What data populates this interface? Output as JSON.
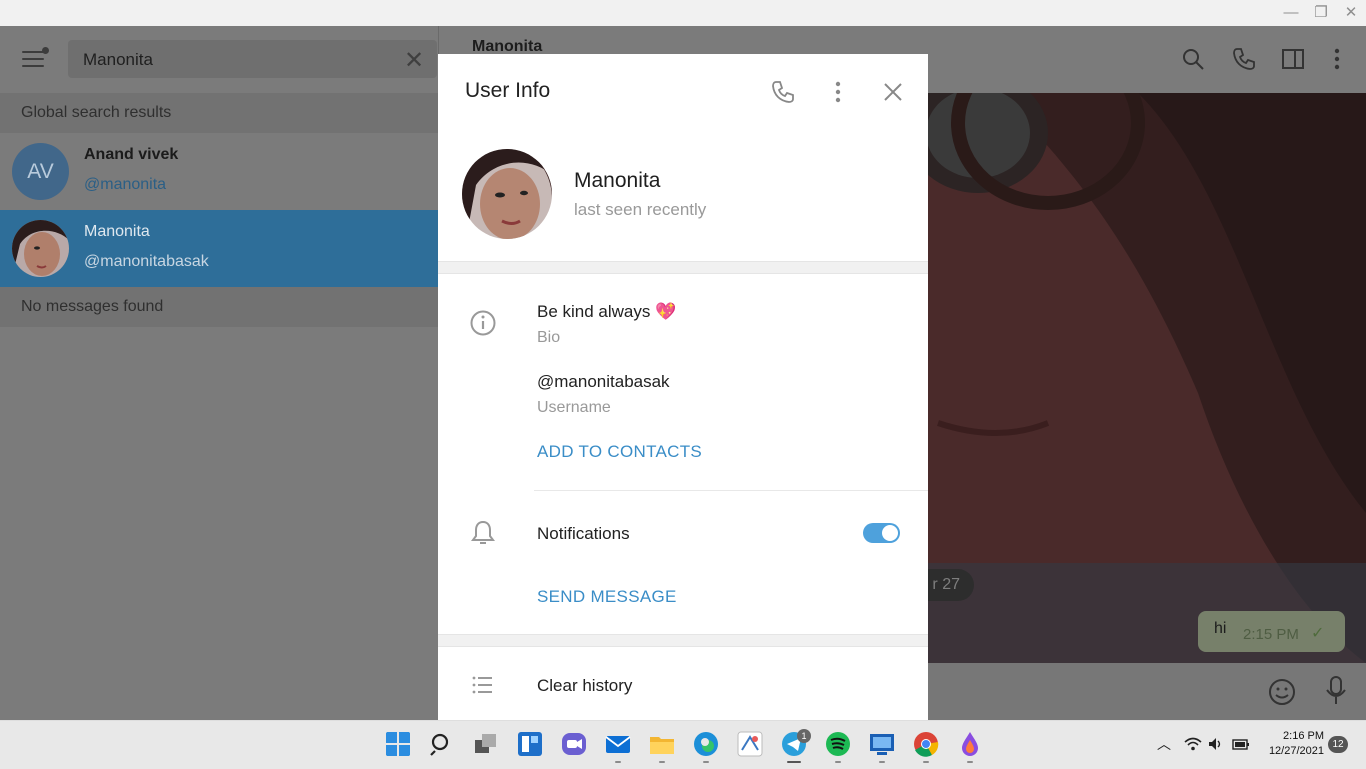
{
  "window": {
    "minimize": "—",
    "restore": "❐",
    "close": "✕"
  },
  "search": {
    "query": "Manonita",
    "clear_icon": "close-icon"
  },
  "sections": {
    "global": "Global search results",
    "no_messages": "No messages found"
  },
  "results": [
    {
      "initials": "AV",
      "name": "Anand vivek",
      "username": "@manonita",
      "avatar_color": "#4b7fa8"
    },
    {
      "initials": "",
      "name": "Manonita",
      "username": "@manonitabasak",
      "selected": true
    }
  ],
  "chat": {
    "title": "Manonita",
    "date_pill": "r 27",
    "message": {
      "text": "hi",
      "time": "2:15 PM",
      "status": "✓"
    }
  },
  "modal": {
    "title": "User Info",
    "name": "Manonita",
    "status": "last seen recently",
    "bio": "Be kind always 💖",
    "bio_label": "Bio",
    "username": "@manonitabasak",
    "username_label": "Username",
    "add_contacts": "ADD TO CONTACTS",
    "notifications": "Notifications",
    "notifications_on": true,
    "send_message": "SEND MESSAGE",
    "clear_history": "Clear history"
  },
  "taskbar": {
    "apps": [
      "start",
      "search",
      "task-view",
      "widgets",
      "chat",
      "mail",
      "file-explorer",
      "edge",
      "app-generic",
      "telegram",
      "spotify",
      "remote-desktop",
      "chrome",
      "paint"
    ],
    "telegram_badge": "1",
    "time": "2:16 PM",
    "date": "12/27/2021",
    "notification_count": "12"
  },
  "colors": {
    "accent": "#3a8dc7",
    "selected_row": "#2e6e99",
    "toggle": "#4ea1dc"
  }
}
